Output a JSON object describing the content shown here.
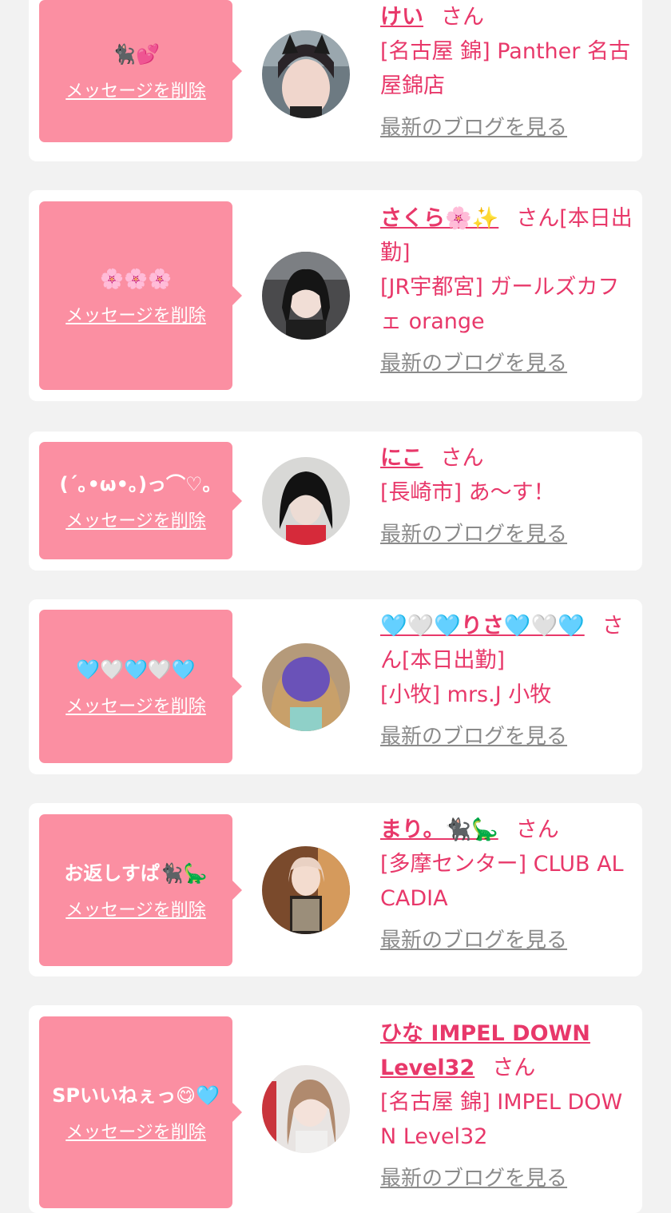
{
  "delete_label": "メッセージを削除",
  "blog_label": "最新のブログを見る",
  "san_label": "さん",
  "colors": {
    "bubble": "#fb8fa2",
    "accent": "#e8386a",
    "muted": "#8a8a8a",
    "background": "#f2f2f2"
  },
  "cards": [
    {
      "message": "🐈‍⬛💕",
      "name": "けい",
      "status": "",
      "shop": "[名古屋 錦] Panther 名古屋錦店"
    },
    {
      "message": "🌸🌸🌸",
      "name": "さくら🌸✨",
      "status": "[本日出勤]",
      "shop": "[JR宇都宮] ガールズカフェ orange"
    },
    {
      "message": "(´｡•ω•｡)っ⌒♡｡",
      "name": "にこ",
      "status": "",
      "shop": "[長崎市] あ〜す！"
    },
    {
      "message": "🩵🤍🩵🤍🩵",
      "name": "🩵🤍🩵りさ🩵🤍🩵",
      "status": "[本日出勤]",
      "shop": "[小牧] mrs.J 小牧"
    },
    {
      "message": "お返しすぱ🐈‍⬛🦕",
      "name": "まり。🐈‍⬛🦕",
      "status": "",
      "shop": "[多摩センター] CLUB ALCADIA"
    },
    {
      "message": "SPいいねぇっ😋🩵",
      "name": "ひな IMPEL DOWN Level32",
      "status": "",
      "shop": "[名古屋 錦] IMPEL DOWN Level32"
    }
  ]
}
